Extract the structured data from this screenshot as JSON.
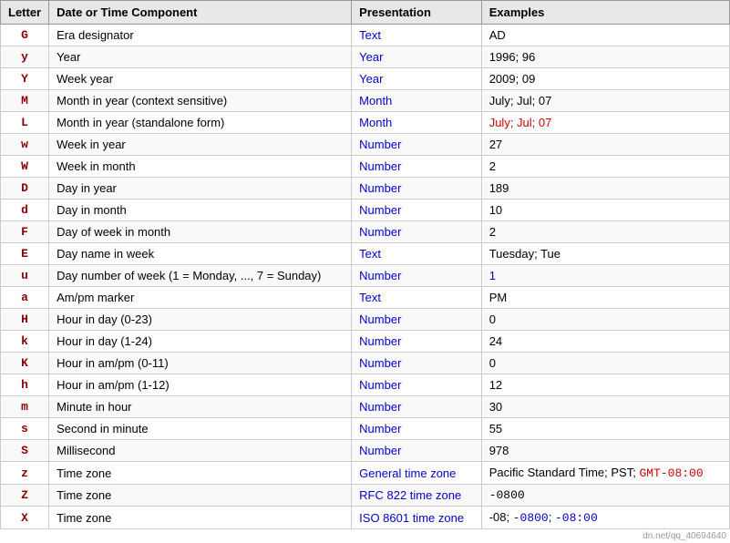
{
  "table": {
    "headers": [
      "Letter",
      "Date or Time Component",
      "Presentation",
      "Examples"
    ],
    "rows": [
      {
        "letter": "G",
        "component": "Era designator",
        "presentation": "Text",
        "examples": "AD",
        "examples_class": ""
      },
      {
        "letter": "y",
        "component": "Year",
        "presentation": "Year",
        "examples": "1996; 96",
        "examples_class": ""
      },
      {
        "letter": "Y",
        "component": "Week year",
        "presentation": "Year",
        "examples": "2009; 09",
        "examples_class": ""
      },
      {
        "letter": "M",
        "component": "Month in year (context sensitive)",
        "presentation": "Month",
        "examples": "July; Jul; 07",
        "examples_class": ""
      },
      {
        "letter": "L",
        "component": "Month in year (standalone form)",
        "presentation": "Month",
        "examples": "July; Jul; 07",
        "examples_class": "red"
      },
      {
        "letter": "w",
        "component": "Week in year",
        "presentation": "Number",
        "examples": "27",
        "examples_class": ""
      },
      {
        "letter": "W",
        "component": "Week in month",
        "presentation": "Number",
        "examples": "2",
        "examples_class": ""
      },
      {
        "letter": "D",
        "component": "Day in year",
        "presentation": "Number",
        "examples": "189",
        "examples_class": ""
      },
      {
        "letter": "d",
        "component": "Day in month",
        "presentation": "Number",
        "examples": "10",
        "examples_class": ""
      },
      {
        "letter": "F",
        "component": "Day of week in month",
        "presentation": "Number",
        "examples": "2",
        "examples_class": ""
      },
      {
        "letter": "E",
        "component": "Day name in week",
        "presentation": "Text",
        "examples": "Tuesday; Tue",
        "examples_class": ""
      },
      {
        "letter": "u",
        "component": "Day number of week (1 = Monday, ..., 7 = Sunday)",
        "presentation": "Number",
        "examples": "1",
        "examples_class": "blue"
      },
      {
        "letter": "a",
        "component": "Am/pm marker",
        "presentation": "Text",
        "examples": "PM",
        "examples_class": ""
      },
      {
        "letter": "H",
        "component": "Hour in day (0-23)",
        "presentation": "Number",
        "examples": "0",
        "examples_class": ""
      },
      {
        "letter": "k",
        "component": "Hour in day (1-24)",
        "presentation": "Number",
        "examples": "24",
        "examples_class": ""
      },
      {
        "letter": "K",
        "component": "Hour in am/pm (0-11)",
        "presentation": "Number",
        "examples": "0",
        "examples_class": ""
      },
      {
        "letter": "h",
        "component": "Hour in am/pm (1-12)",
        "presentation": "Number",
        "examples": "12",
        "examples_class": ""
      },
      {
        "letter": "m",
        "component": "Minute in hour",
        "presentation": "Number",
        "examples": "30",
        "examples_class": ""
      },
      {
        "letter": "s",
        "component": "Second in minute",
        "presentation": "Number",
        "examples": "55",
        "examples_class": ""
      },
      {
        "letter": "S",
        "component": "Millisecond",
        "presentation": "Number",
        "examples": "978",
        "examples_class": ""
      },
      {
        "letter": "z",
        "component": "Time zone",
        "presentation": "General time zone",
        "examples_complex": true,
        "ex_before": "Pacific Standard Time; PST; ",
        "ex_mono": "GMT-08:00",
        "ex_after": "",
        "ex_mono_color": "red"
      },
      {
        "letter": "Z",
        "component": "Time zone",
        "presentation": "RFC 822 time zone",
        "examples": "-0800",
        "examples_class": "mono"
      },
      {
        "letter": "X",
        "component": "Time zone",
        "presentation": "ISO 8601 time zone",
        "examples_complex": true,
        "ex_before": "-08; ",
        "ex_mono": "-0800",
        "ex_after": "; ",
        "ex_mono2": "-08:00",
        "ex_mono2_color": "blue",
        "ex_mono_color": "blue"
      }
    ]
  }
}
